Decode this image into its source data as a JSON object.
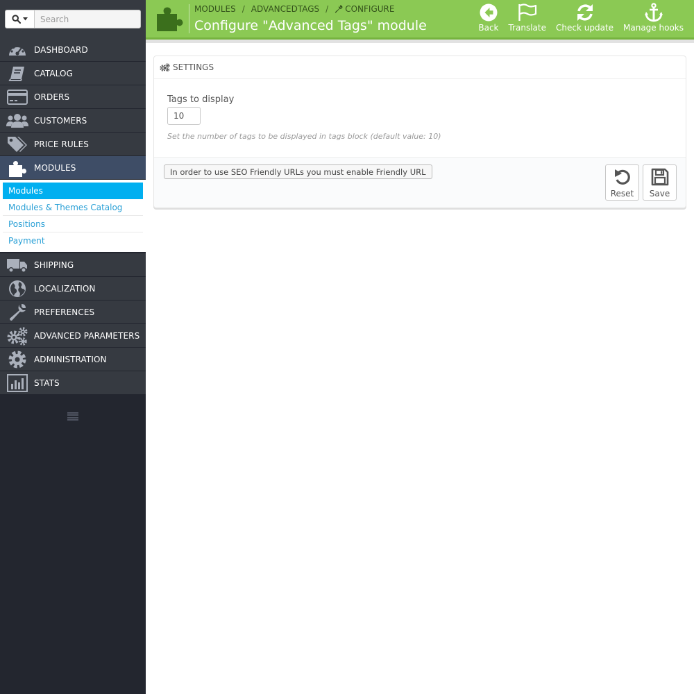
{
  "search": {
    "placeholder": "Search"
  },
  "sidebar": {
    "items": [
      {
        "label": "DASHBOARD",
        "icon": "dashboard-icon"
      },
      {
        "label": "CATALOG",
        "icon": "book-icon"
      },
      {
        "label": "ORDERS",
        "icon": "credit-card-icon"
      },
      {
        "label": "CUSTOMERS",
        "icon": "users-icon"
      },
      {
        "label": "PRICE RULES",
        "icon": "tags-icon"
      },
      {
        "label": "MODULES",
        "icon": "puzzle-icon",
        "active": true
      }
    ],
    "submenu": [
      {
        "label": "Modules",
        "active": true
      },
      {
        "label": "Modules & Themes Catalog"
      },
      {
        "label": "Positions"
      },
      {
        "label": "Payment"
      }
    ],
    "items_after": [
      {
        "label": "SHIPPING",
        "icon": "truck-icon"
      },
      {
        "label": "LOCALIZATION",
        "icon": "globe-icon"
      },
      {
        "label": "PREFERENCES",
        "icon": "wrench-icon"
      },
      {
        "label": "ADVANCED PARAMETERS",
        "icon": "cogs-icon"
      },
      {
        "label": "ADMINISTRATION",
        "icon": "gear-icon"
      },
      {
        "label": "STATS",
        "icon": "bar-chart-icon"
      }
    ]
  },
  "header": {
    "breadcrumb": [
      "MODULES",
      "ADVANCEDTAGS",
      "CONFIGURE"
    ],
    "title": "Configure \"Advanced Tags\" module",
    "toolbar": {
      "back": "Back",
      "translate": "Translate",
      "check_update": "Check update",
      "manage_hooks": "Manage hooks"
    }
  },
  "panel": {
    "heading": "SETTINGS",
    "field_label": "Tags to display",
    "field_value": "10",
    "help_text": "Set the number of tags to be displayed in tags block (default value: 10)",
    "seo_notice": "In order to use SEO Friendly URLs you must enable Friendly URL",
    "reset_label": "Reset",
    "save_label": "Save"
  },
  "colors": {
    "header_bg": "#8bc954",
    "sidebar_bg": "#363a41",
    "sidebar_dark": "#23262f",
    "active_menu": "#3e4d66",
    "active_submenu": "#00aff0",
    "link": "#2aa0d6"
  }
}
